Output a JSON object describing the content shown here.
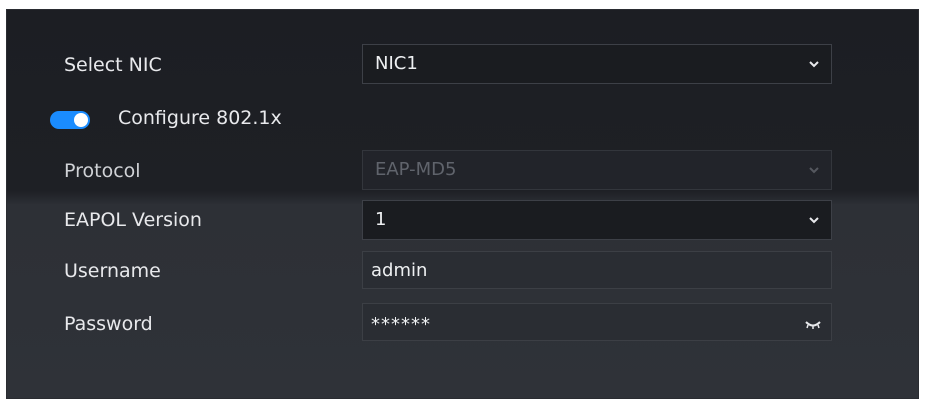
{
  "form": {
    "select_nic": {
      "label": "Select NIC",
      "value": "NIC1",
      "icon": "chevron-down-icon"
    },
    "configure_8021x": {
      "label": "Configure 802.1x",
      "enabled": true,
      "accent_color": "#1a8cff"
    },
    "protocol": {
      "label": "Protocol",
      "value": "EAP-MD5",
      "disabled": true,
      "icon": "chevron-down-icon"
    },
    "eapol_version": {
      "label": "EAPOL Version",
      "value": "1",
      "icon": "chevron-down-icon"
    },
    "username": {
      "label": "Username",
      "value": "admin"
    },
    "password": {
      "label": "Password",
      "value": "******",
      "icon": "eye-closed-icon"
    }
  }
}
